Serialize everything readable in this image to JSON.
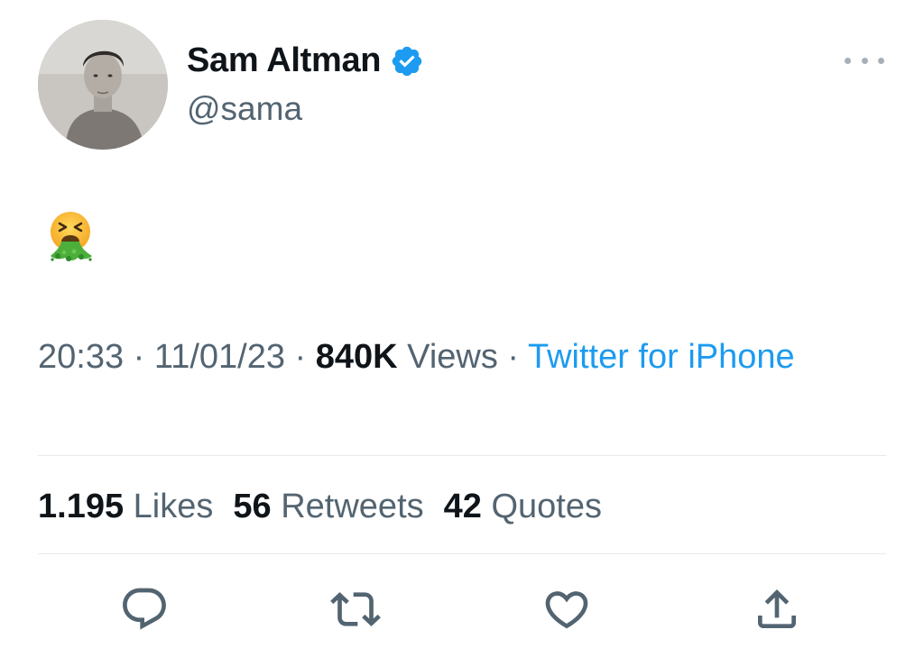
{
  "author": {
    "display_name": "Sam Altman",
    "handle": "@sama",
    "verified": true,
    "verified_color": "#1d9bf0"
  },
  "tweet": {
    "text": "🤮"
  },
  "meta": {
    "time": "20:33",
    "separator": " · ",
    "date": "11/01/23",
    "views_count": "840K",
    "views_label": "Views",
    "source": "Twitter for iPhone"
  },
  "stats": {
    "likes_count": "1.195",
    "likes_label": "Likes",
    "retweets_count": "56",
    "retweets_label": "Retweets",
    "quotes_count": "42",
    "quotes_label": "Quotes"
  },
  "actions": [
    {
      "name": "reply",
      "icon": "reply-icon"
    },
    {
      "name": "retweet",
      "icon": "retweet-icon"
    },
    {
      "name": "like",
      "icon": "heart-icon"
    },
    {
      "name": "share",
      "icon": "share-icon"
    }
  ],
  "colors": {
    "text_primary": "#0f1419",
    "text_secondary": "#536471",
    "link": "#1d9bf0",
    "divider": "#e6e9eb"
  }
}
